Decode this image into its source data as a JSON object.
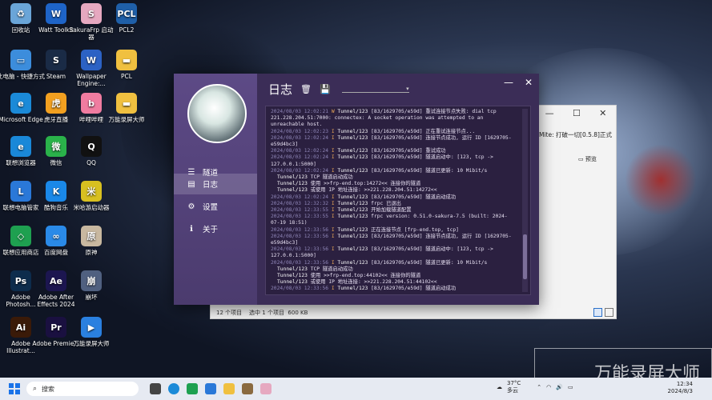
{
  "desktop": {
    "icons": [
      {
        "label": "回收站",
        "color": "#6aa5d8",
        "glyph": "♻"
      },
      {
        "label": "Watt Toolkit",
        "color": "#1e64c8",
        "glyph": "W"
      },
      {
        "label": "SakuraFrp 启动器",
        "color": "#e6a8c0",
        "glyph": "S"
      },
      {
        "label": "PCL2",
        "color": "#1f5fa8",
        "glyph": "PCL"
      },
      {
        "label": "此电脑 - 快捷方式",
        "color": "#3c8ddc",
        "glyph": "▭"
      },
      {
        "label": "Steam",
        "color": "#1a2b46",
        "glyph": "S"
      },
      {
        "label": "Wallpaper Engine:...",
        "color": "#2c62c4",
        "glyph": "W"
      },
      {
        "label": "PCL",
        "color": "#f0c040",
        "glyph": "▬"
      },
      {
        "label": "Microsoft Edge",
        "color": "#1b8ad8",
        "glyph": "e"
      },
      {
        "label": "虎牙直播",
        "color": "#f2a020",
        "glyph": "虎"
      },
      {
        "label": "哔哩哔哩",
        "color": "#f07ca0",
        "glyph": "b"
      },
      {
        "label": "万能录屏大师",
        "color": "#f0c040",
        "glyph": "▬"
      },
      {
        "label": "联想浏览器",
        "color": "#1a88d8",
        "glyph": "e"
      },
      {
        "label": "微信",
        "color": "#2ab24a",
        "glyph": "微"
      },
      {
        "label": "QQ",
        "color": "#111111",
        "glyph": "Q"
      },
      {
        "label": "联想电脑管家",
        "color": "#2a78d8",
        "glyph": "L"
      },
      {
        "label": "酷狗音乐",
        "color": "#1a88e8",
        "glyph": "K"
      },
      {
        "label": "米哈游启动器",
        "color": "#d8c020",
        "glyph": "米"
      },
      {
        "label": "联想应用商店",
        "color": "#1ea050",
        "glyph": "◇"
      },
      {
        "label": "百度网盘",
        "color": "#2a8ae8",
        "glyph": "∞"
      },
      {
        "label": "原神",
        "color": "#c8b8a0",
        "glyph": "原"
      },
      {
        "label": "Adobe Photosh...",
        "color": "#0d2c4c",
        "glyph": "Ps"
      },
      {
        "label": "Adobe After Effects 2024",
        "color": "#1c1650",
        "glyph": "Ae"
      },
      {
        "label": "崩坏",
        "color": "#506080",
        "glyph": "崩"
      },
      {
        "label": "Adobe Illustrat...",
        "color": "#3a1a08",
        "glyph": "Ai"
      },
      {
        "label": "Adobe Premie...",
        "color": "#1a1040",
        "glyph": "Pr"
      },
      {
        "label": "万能录屏大师",
        "color": "#2a80e0",
        "glyph": "▶"
      }
    ]
  },
  "explorer": {
    "path_text": "Mite: 打破一切[0.5.8]正式",
    "preview_label": "预览",
    "status_items": "12 个项目",
    "status_selected": "选中 1 个项目",
    "status_size": "600 KB",
    "win_min": "—",
    "win_max": "☐",
    "win_close": "✕"
  },
  "app": {
    "header_title": "日志",
    "nav": [
      {
        "label": "隧道",
        "icon": "☰"
      },
      {
        "label": "日志",
        "icon": "▤"
      },
      {
        "label": "设置",
        "icon": "⚙"
      },
      {
        "label": "关于",
        "icon": "ℹ"
      }
    ],
    "win_min": "—",
    "win_close": "✕",
    "select_value": "",
    "logs": [
      {
        "ts": "2024/08/03 12:02:21",
        "lv": "W",
        "tn": "Tunnel/123",
        "msg": "[83/1629705/e59d] 重试连接节点失败: dial tcp 221.228.204.51:7000: connectex: A socket operation was attempted to an unreachable host."
      },
      {
        "ts": "2024/08/03 12:02:23",
        "lv": "I",
        "tn": "Tunnel/123",
        "msg": "[83/1629705/e59d] 正在重试连接节点..."
      },
      {
        "ts": "2024/08/03 12:02:24",
        "lv": "I",
        "tn": "Tunnel/123",
        "msg": "[83/1629705/e59d] 连接节点成功, 运行 ID [1629705-e59d4bc3]"
      },
      {
        "ts": "2024/08/03 12:02:24",
        "lv": "I",
        "tn": "Tunnel/123",
        "msg": "[83/1629705/e59d] 重试成功"
      },
      {
        "ts": "2024/08/03 12:02:24",
        "lv": "I",
        "tn": "Tunnel/123",
        "msg": "[83/1629705/e59d] 隧道启动中: [123, tcp -> 127.0.0.1:5000]"
      },
      {
        "ts": "2024/08/03 12:02:24",
        "lv": "I",
        "tn": "Tunnel/123",
        "msg": "[83/1629705/e59d] 隧道已更新: 10 Mibit/s"
      },
      {
        "ts": "",
        "lv": "",
        "tn": "Tunnel/123",
        "msg": "TCP 隧道启动成功"
      },
      {
        "ts": "",
        "lv": "",
        "tn": "Tunnel/123",
        "msg": "使用 >>frp-end.top:14272<< 连接你的隧道"
      },
      {
        "ts": "",
        "lv": "",
        "tn": "Tunnel/123",
        "msg": "或使用 IP 地址连接: >>221.228.204.51:14272<<"
      },
      {
        "ts": "2024/08/03 12:02:24",
        "lv": "I",
        "tn": "Tunnel/123",
        "msg": "[83/1629705/e59d] 隧道启动成功"
      },
      {
        "ts": "2024/08/03 12:32:32",
        "lv": "I",
        "tn": "Tunnel/123",
        "msg": "frpc 已退出"
      },
      {
        "ts": "2024/08/03 12:33:55",
        "lv": "I",
        "tn": "Tunnel/123",
        "msg": "开始加载隧道配置"
      },
      {
        "ts": "2024/08/03 12:33:55",
        "lv": "I",
        "tn": "Tunnel/123",
        "msg": "frpc version: 0.51.0-sakura-7.5 (built: 2024-07-19 18:51)"
      },
      {
        "ts": "2024/08/03 12:33:56",
        "lv": "I",
        "tn": "Tunnel/123",
        "msg": "正在连接节点 [frp-end.top, tcp]"
      },
      {
        "ts": "2024/08/03 12:33:56",
        "lv": "I",
        "tn": "Tunnel/123",
        "msg": "[83/1629705/e59d] 连接节点成功, 运行 ID [1629705-e59d4bc3]"
      },
      {
        "ts": "2024/08/03 12:33:56",
        "lv": "I",
        "tn": "Tunnel/123",
        "msg": "[83/1629705/e59d] 隧道启动中: [123, tcp -> 127.0.0.1:5000]"
      },
      {
        "ts": "2024/08/03 12:33:56",
        "lv": "I",
        "tn": "Tunnel/123",
        "msg": "[83/1629705/e59d] 隧道已更新: 10 Mibit/s"
      },
      {
        "ts": "",
        "lv": "",
        "tn": "Tunnel/123",
        "msg": "TCP 隧道启动成功"
      },
      {
        "ts": "",
        "lv": "",
        "tn": "Tunnel/123",
        "msg": "使用 >>frp-end.top:44102<< 连接你的隧道"
      },
      {
        "ts": "",
        "lv": "",
        "tn": "Tunnel/123",
        "msg": "或使用 IP 地址连接: >>221.228.204.51:44102<<"
      },
      {
        "ts": "2024/08/03 12:33:56",
        "lv": "I",
        "tn": "Tunnel/123",
        "msg": "[83/1629705/e59d] 隧道启动成功"
      }
    ]
  },
  "taskbar": {
    "search_placeholder": "搜索",
    "weather_temp": "37°C",
    "weather_desc": "多云",
    "time": "12:34",
    "date": "2024/8/3"
  },
  "watermark": "万能录屏大师"
}
